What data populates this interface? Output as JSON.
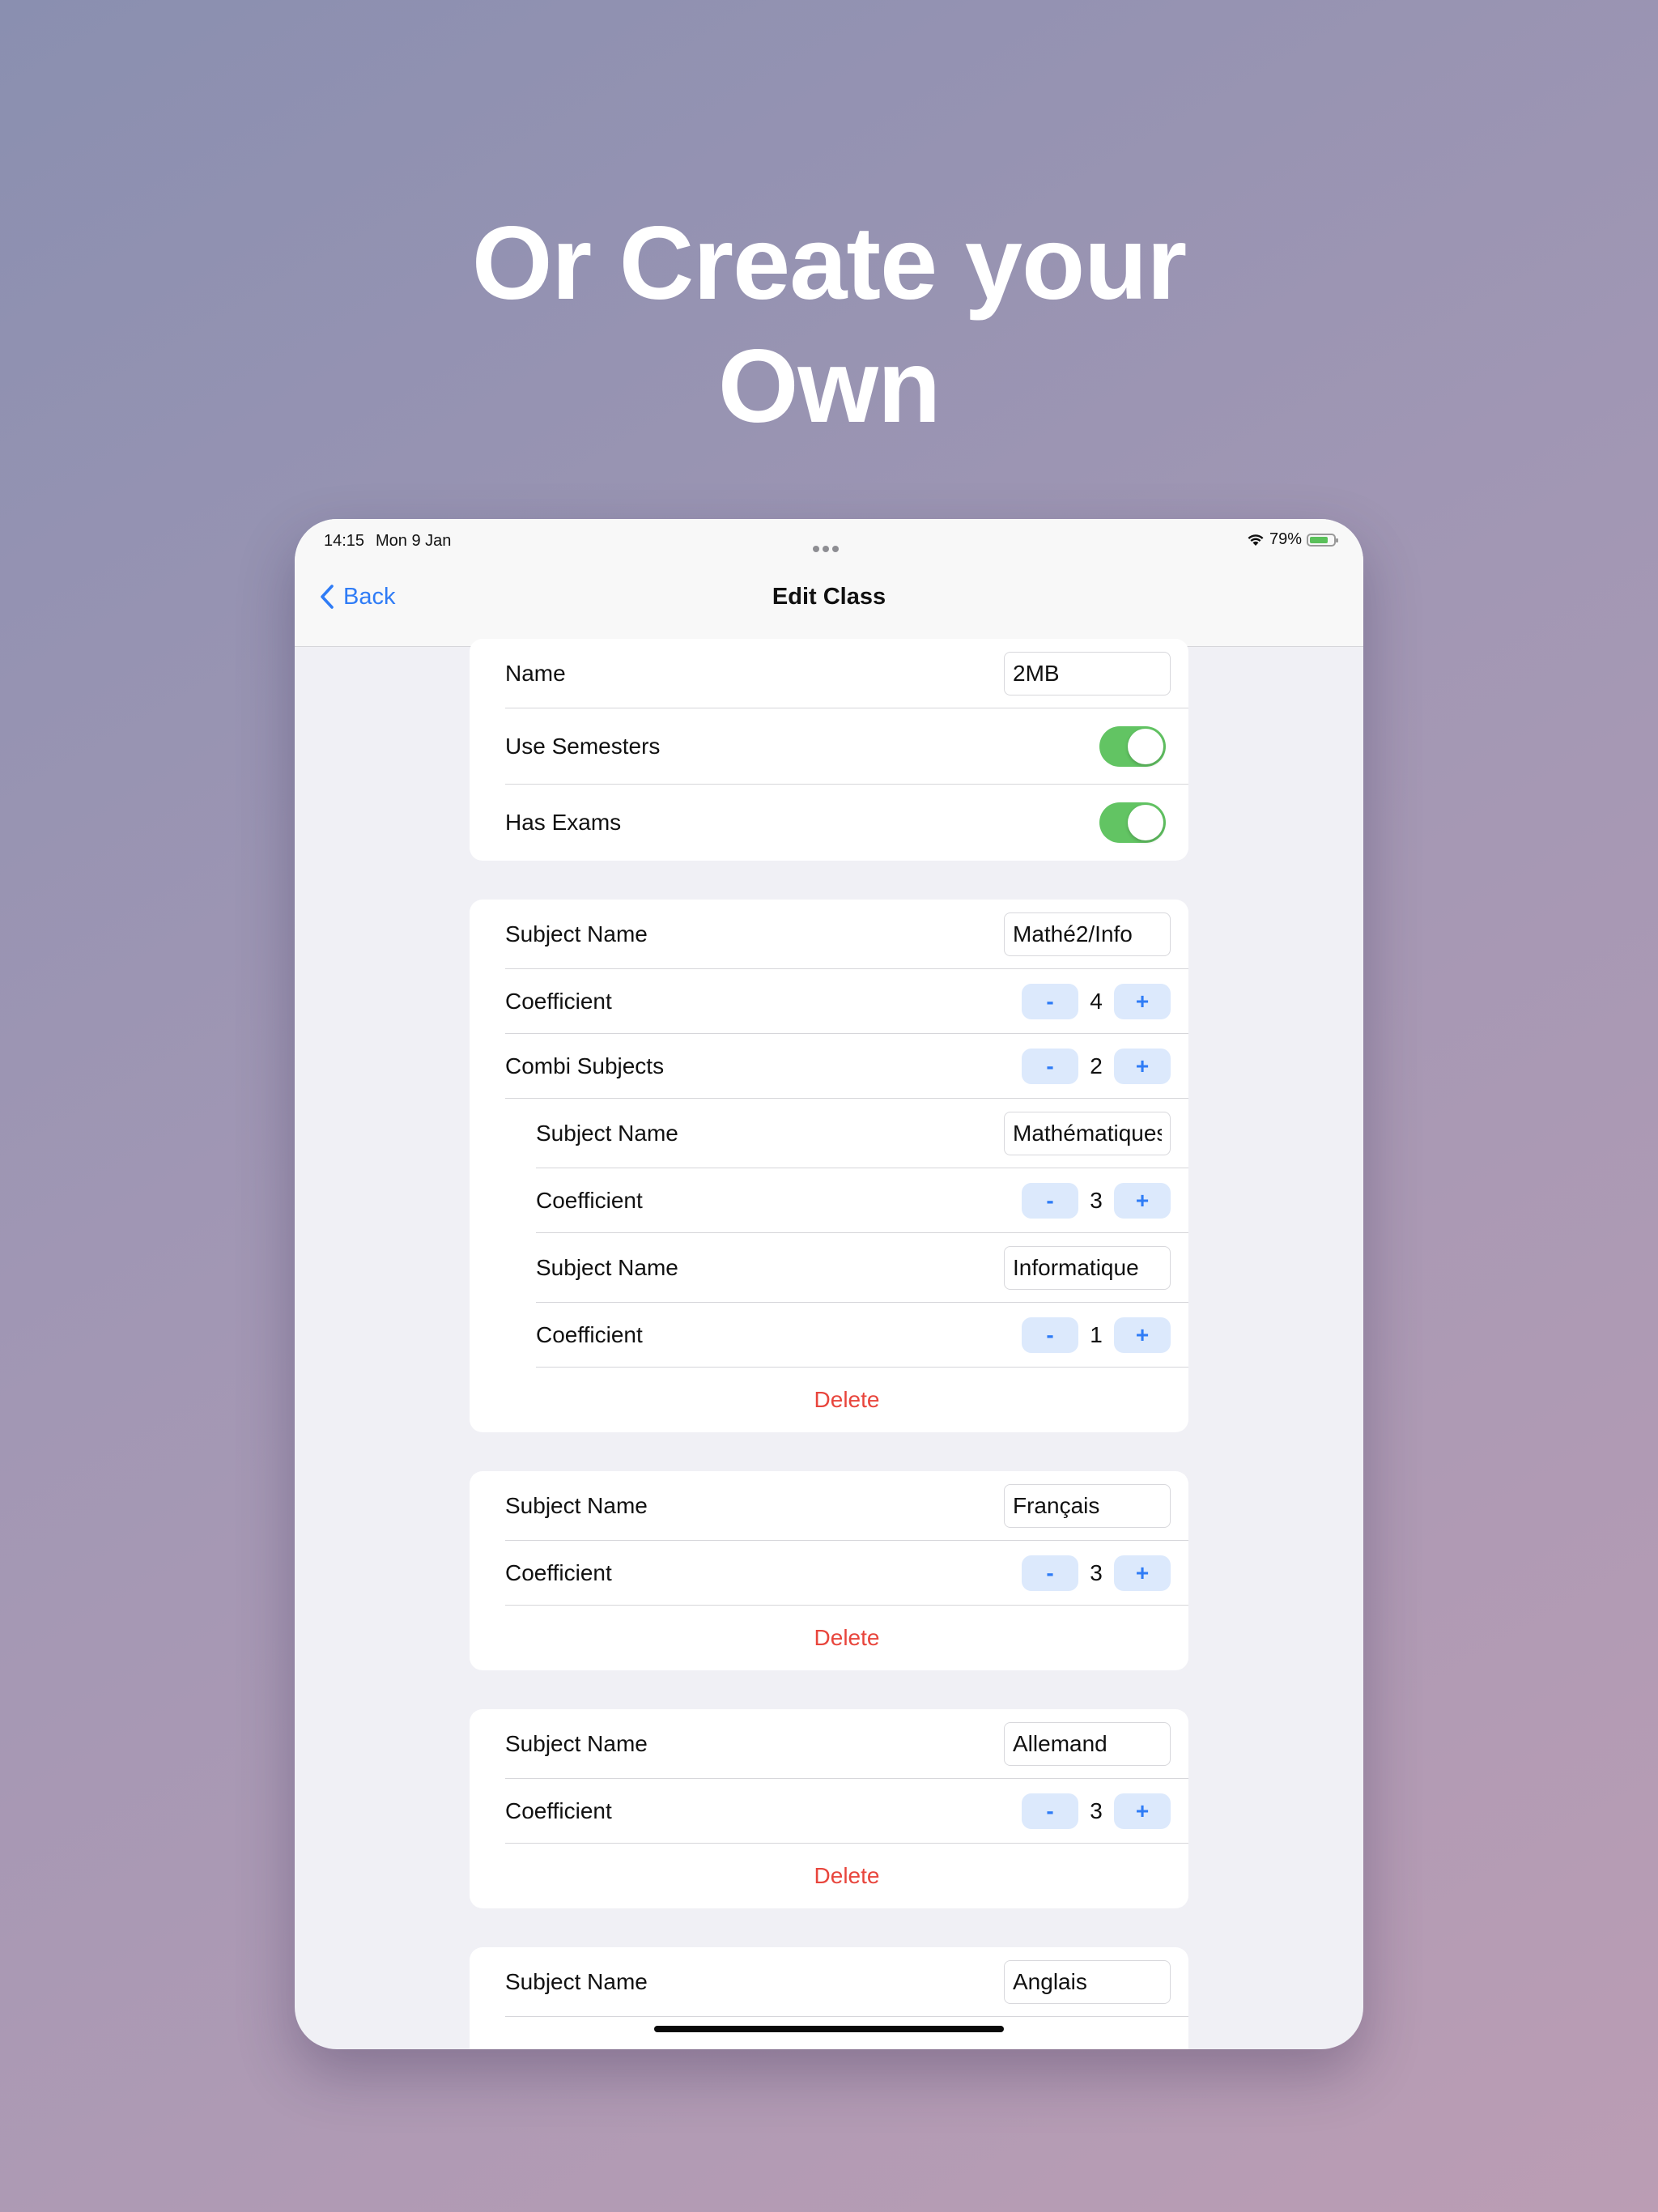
{
  "headline": {
    "line1": "Or Create your",
    "line2": "Own"
  },
  "status_bar": {
    "time": "14:15",
    "date": "Mon 9 Jan",
    "battery": "79%",
    "battery_level": 0.79
  },
  "nav": {
    "back_label": "Back",
    "title": "Edit Class"
  },
  "class_settings": {
    "name_label": "Name",
    "name_value": "2MB",
    "use_semesters_label": "Use Semesters",
    "use_semesters_on": true,
    "has_exams_label": "Has Exams",
    "has_exams_on": true
  },
  "subjects": [
    {
      "name_label": "Subject Name",
      "name_value": "Mathé2/Info",
      "coef_label": "Coefficient",
      "coef_value": "4",
      "combi_label": "Combi Subjects",
      "combi_value": "2",
      "combi": [
        {
          "name_label": "Subject Name",
          "name_value": "Mathématiques",
          "coef_label": "Coefficient",
          "coef_value": "3"
        },
        {
          "name_label": "Subject Name",
          "name_value": "Informatique",
          "coef_label": "Coefficient",
          "coef_value": "1"
        }
      ],
      "delete_label": "Delete"
    },
    {
      "name_label": "Subject Name",
      "name_value": "Français",
      "coef_label": "Coefficient",
      "coef_value": "3",
      "delete_label": "Delete"
    },
    {
      "name_label": "Subject Name",
      "name_value": "Allemand",
      "coef_label": "Coefficient",
      "coef_value": "3",
      "delete_label": "Delete"
    },
    {
      "name_label": "Subject Name",
      "name_value": "Anglais"
    }
  ],
  "stepper": {
    "minus": "-",
    "plus": "+"
  },
  "colors": {
    "accent": "#2f7cf6",
    "toggle_on": "#62c463",
    "destructive": "#e8453c"
  }
}
